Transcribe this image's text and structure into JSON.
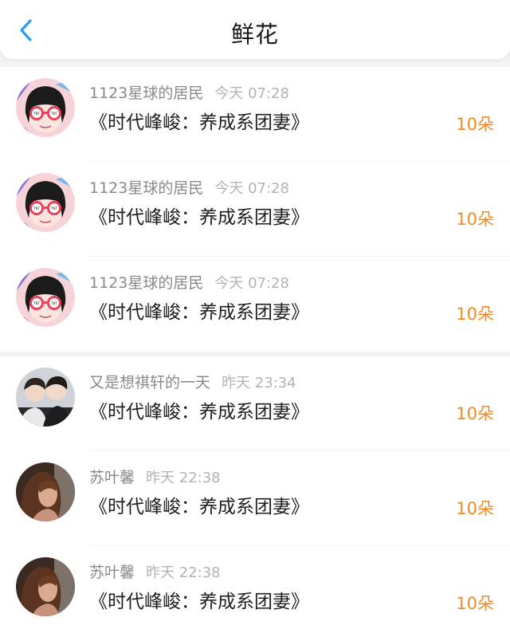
{
  "header": {
    "title": "鲜花",
    "back_icon": "chevron-left-icon",
    "accent_color": "#2a9bf0"
  },
  "colors": {
    "count": "#f28a1f",
    "username": "#8a8a8a",
    "time": "#b3b3b3"
  },
  "records": [
    {
      "avatar_icon": "cartoon-girl-sunglasses-avatar",
      "username": "1123星球的居民",
      "time": "今天 07:28",
      "gift": "《时代峰峻：养成系团妻》",
      "count": "10朵"
    },
    {
      "avatar_icon": "cartoon-girl-sunglasses-avatar",
      "username": "1123星球的居民",
      "time": "今天 07:28",
      "gift": "《时代峰峻：养成系团妻》",
      "count": "10朵"
    },
    {
      "avatar_icon": "cartoon-girl-sunglasses-avatar",
      "username": "1123星球的居民",
      "time": "今天 07:28",
      "gift": "《时代峰峻：养成系团妻》",
      "count": "10朵"
    },
    {
      "avatar_icon": "two-boys-photo-avatar",
      "username": "又是想祺轩的一天",
      "time": "昨天 23:34",
      "gift": "《时代峰峻：养成系团妻》",
      "count": "10朵"
    },
    {
      "avatar_icon": "woman-photo-avatar",
      "username": "苏叶馨",
      "time": "昨天 22:38",
      "gift": "《时代峰峻：养成系团妻》",
      "count": "10朵"
    },
    {
      "avatar_icon": "woman-photo-avatar",
      "username": "苏叶馨",
      "time": "昨天 22:38",
      "gift": "《时代峰峻：养成系团妻》",
      "count": "10朵"
    }
  ]
}
